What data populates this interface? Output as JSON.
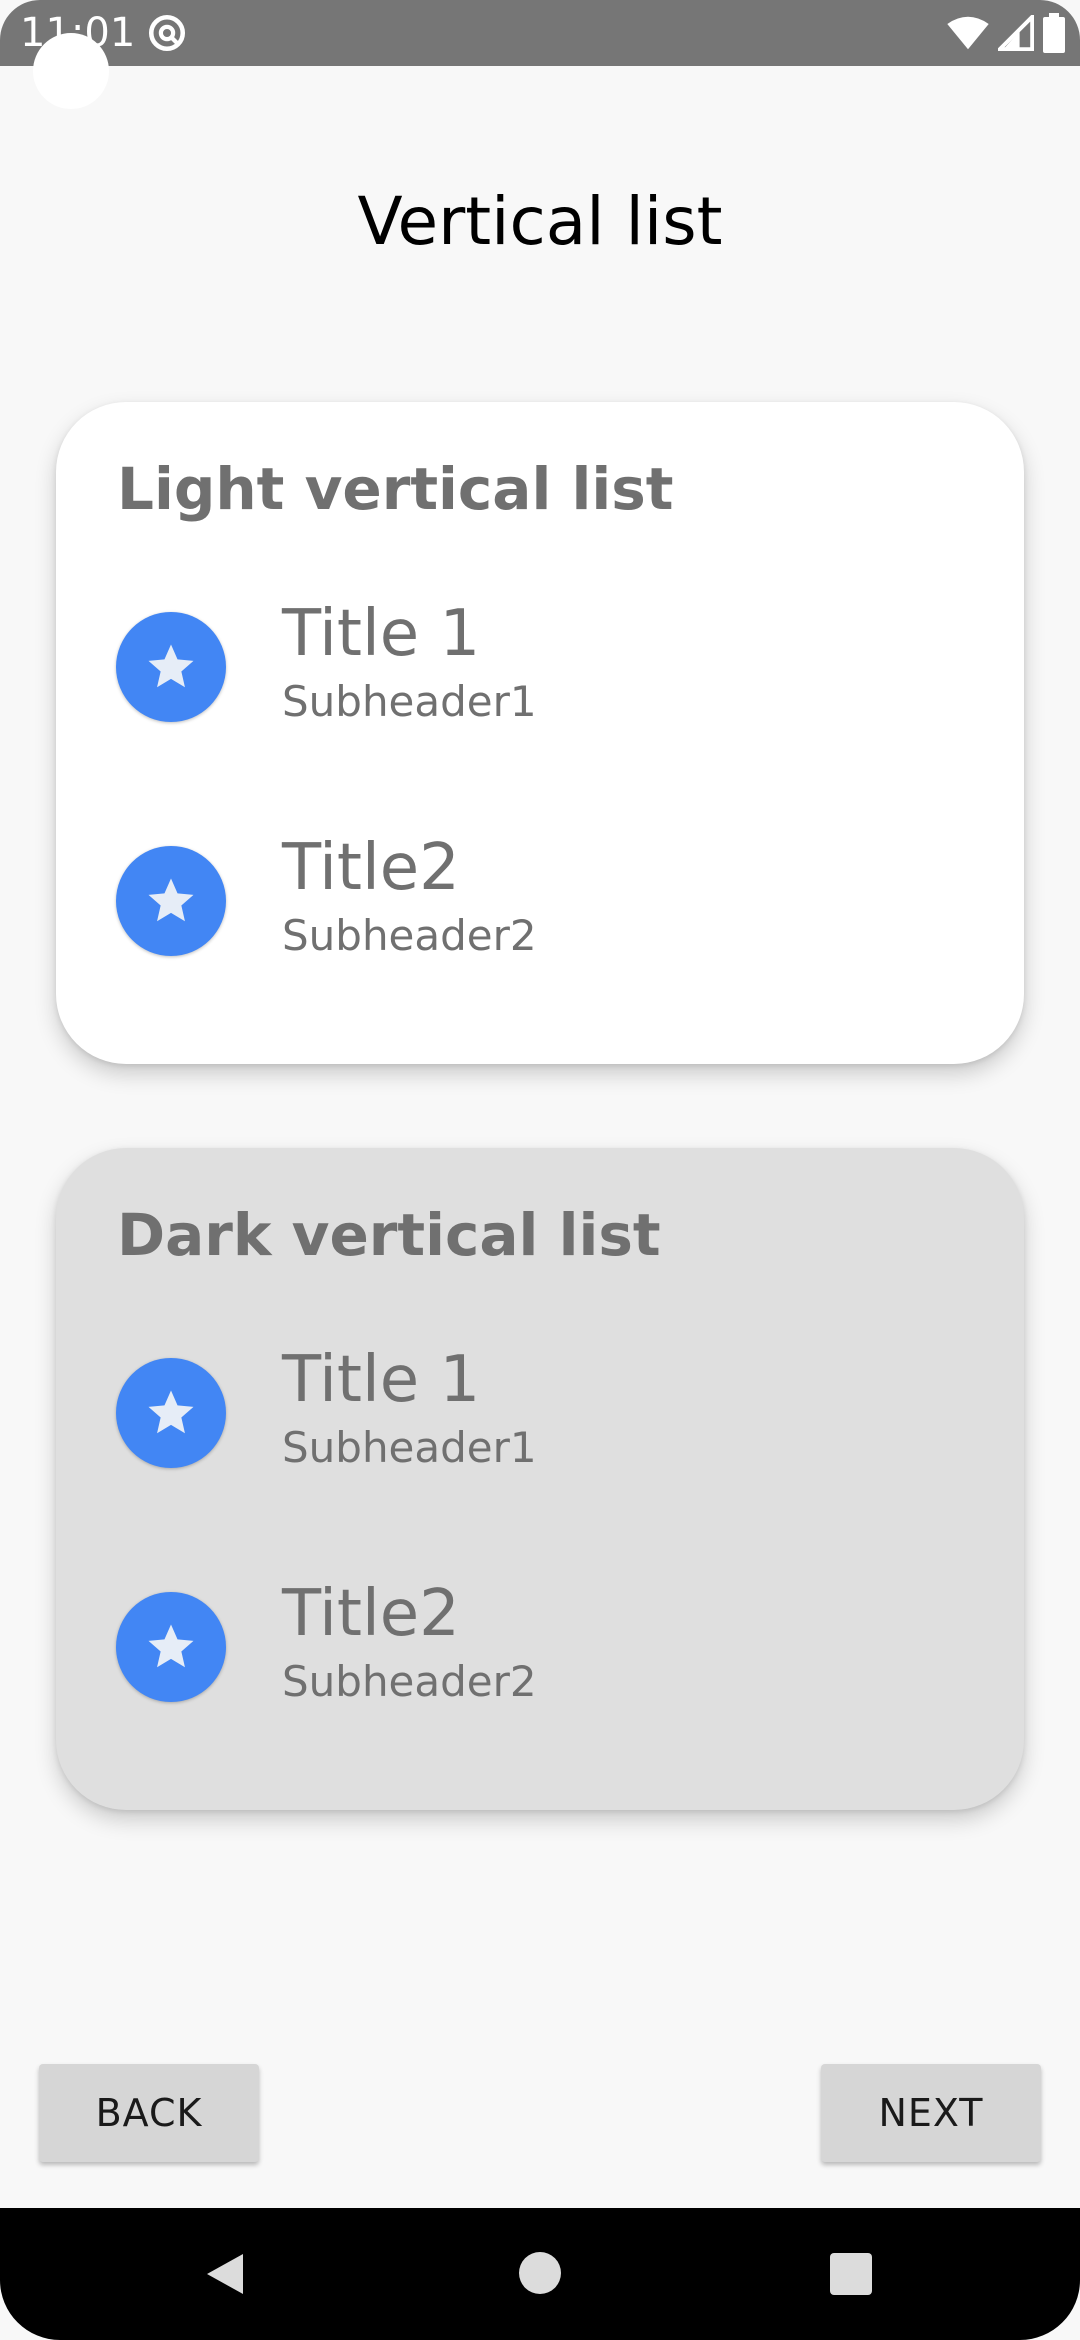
{
  "status_bar": {
    "time": "11:01",
    "app_icon": "at-sign-icon",
    "wifi_icon": "wifi-icon",
    "signal_icon": "cell-signal-icon",
    "battery_icon": "battery-icon"
  },
  "page": {
    "title": "Vertical list"
  },
  "light_card": {
    "heading": "Light vertical list",
    "items": [
      {
        "title": "Title 1",
        "subtitle": "Subheader1",
        "icon": "star-icon"
      },
      {
        "title": "Title2",
        "subtitle": "Subheader2",
        "icon": "star-icon"
      }
    ]
  },
  "dark_card": {
    "heading": "Dark vertical list",
    "items": [
      {
        "title": "Title 1",
        "subtitle": "Subheader1",
        "icon": "star-icon"
      },
      {
        "title": "Title2",
        "subtitle": "Subheader2",
        "icon": "star-icon"
      }
    ]
  },
  "footer": {
    "back_label": "BACK",
    "next_label": "NEXT"
  },
  "nav_bar": {
    "back_icon": "nav-back-icon",
    "home_icon": "nav-home-icon",
    "recents_icon": "nav-recents-icon"
  },
  "colors": {
    "accent": "#4286f4",
    "light_card_bg": "#ffffff",
    "dark_card_bg": "#dfdfdf",
    "status_bar_bg": "#767676",
    "button_bg": "#d6d6d6"
  }
}
